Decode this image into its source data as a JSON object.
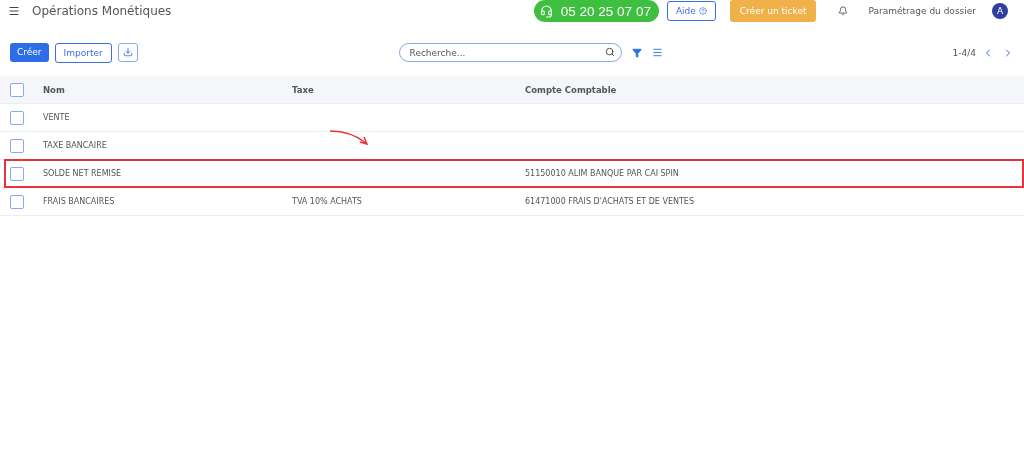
{
  "header": {
    "title": "Opérations Monétiques",
    "phone": "05 20 25 07 07",
    "help": "Aide",
    "ticket": "Créer un ticket",
    "settings": "Paramétrage du dossier",
    "avatar": "A"
  },
  "toolbar": {
    "create": "Créer",
    "import": "Importer",
    "search": {
      "placeholder": "Recherche..."
    },
    "pager": "1-4/4"
  },
  "table": {
    "columns": [
      "Nom",
      "Taxe",
      "Compte Comptable"
    ],
    "all_checked": false,
    "rows": [
      {
        "cells": [
          "VENTE",
          "",
          ""
        ],
        "checked": false,
        "highlighted": false
      },
      {
        "cells": [
          "TAXE BANCAIRE",
          "",
          ""
        ],
        "checked": false,
        "highlighted": false
      },
      {
        "cells": [
          "SOLDE NET REMISE",
          "",
          "51150010 ALIM BANQUE PAR CAI SPIN"
        ],
        "checked": false,
        "highlighted": true
      },
      {
        "cells": [
          "FRAIS BANCAIRES",
          "TVA 10% ACHATS",
          "61471000 FRAIS D'ACHATS ET DE VENTES"
        ],
        "checked": false,
        "highlighted": false
      }
    ]
  }
}
